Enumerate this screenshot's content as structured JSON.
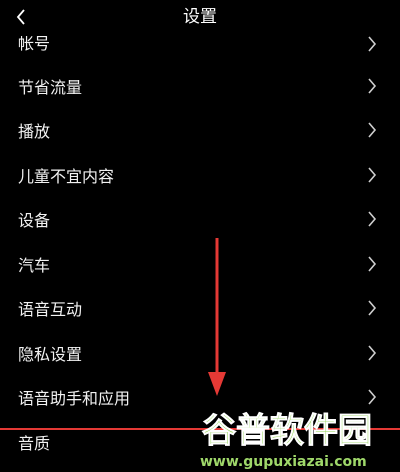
{
  "header": {
    "title": "设置",
    "back_icon": "chevron-left-icon"
  },
  "settings": {
    "items": [
      {
        "label": "帐号"
      },
      {
        "label": "节省流量"
      },
      {
        "label": "播放"
      },
      {
        "label": "儿童不宜内容"
      },
      {
        "label": "设备"
      },
      {
        "label": "汽车"
      },
      {
        "label": "语音互动"
      },
      {
        "label": "隐私设置"
      },
      {
        "label": "语音助手和应用"
      },
      {
        "label": "音质"
      }
    ]
  },
  "annotation": {
    "arrow_color": "#e53935",
    "highlight_color": "#e53935"
  },
  "watermark": {
    "brand": "谷普软件园",
    "url": "www.gupuxiazai.com"
  }
}
